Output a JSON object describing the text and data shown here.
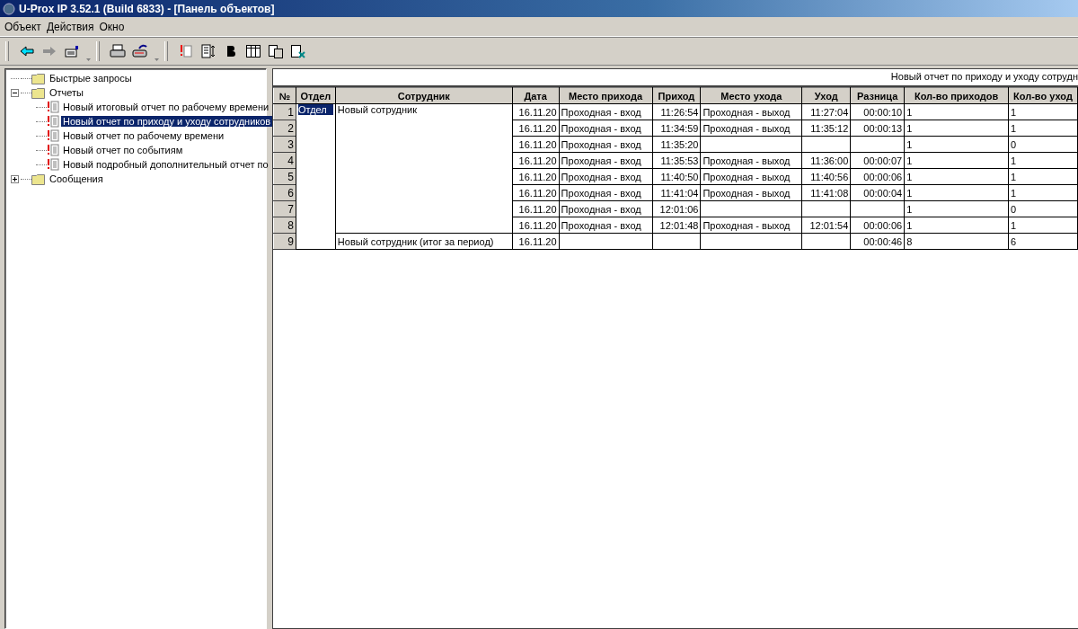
{
  "window": {
    "title": "U-Prox IP 3.52.1 (Build 6833) - [Панель объектов]"
  },
  "menu": [
    "Объект",
    "Действия",
    "Окно"
  ],
  "tree": [
    {
      "label": "Быстрые запросы",
      "kind": "folder",
      "selected": false
    },
    {
      "label": "Отчеты",
      "kind": "folder",
      "expanded": true,
      "selected": false,
      "children": [
        {
          "label": "Новый итоговый отчет по рабочему времени",
          "kind": "report",
          "selected": false
        },
        {
          "label": "Новый отчет по приходу и уходу сотрудников",
          "kind": "report",
          "selected": true
        },
        {
          "label": "Новый отчет по рабочему времени",
          "kind": "report",
          "selected": false
        },
        {
          "label": "Новый отчет по событиям",
          "kind": "report",
          "selected": false
        },
        {
          "label": "Новый подробный дополнительный отчет по",
          "kind": "report",
          "selected": false
        }
      ]
    },
    {
      "label": "Сообщения",
      "kind": "folder",
      "expanded": false,
      "selected": false
    }
  ],
  "report": {
    "title": "Новый отчет по приходу и уходу сотрудн",
    "columns": [
      "№",
      "Отдел",
      "Сотрудник",
      "Дата",
      "Место прихода",
      "Приход",
      "Место ухода",
      "Уход",
      "Разница",
      "Кол-во приходов",
      "Кол-во уход"
    ],
    "department": {
      "text": "Отдел",
      "selected": true
    },
    "employee": "Новый сотрудник",
    "rows": [
      {
        "num": "1",
        "date": "16.11.20",
        "in_place": "Проходная  - вход",
        "in_time": "11:26:54",
        "out_place": "Проходная  - выход",
        "out_time": "11:27:04",
        "diff": "00:00:10",
        "in_count": "1",
        "out_count": "1"
      },
      {
        "num": "2",
        "date": "16.11.20",
        "in_place": "Проходная  - вход",
        "in_time": "11:34:59",
        "out_place": "Проходная  - выход",
        "out_time": "11:35:12",
        "diff": "00:00:13",
        "in_count": "1",
        "out_count": "1"
      },
      {
        "num": "3",
        "date": "16.11.20",
        "in_place": "Проходная  - вход",
        "in_time": "11:35:20",
        "in_count": "1",
        "out_count": "0"
      },
      {
        "num": "4",
        "date": "16.11.20",
        "in_place": "Проходная  - вход",
        "in_time": "11:35:53",
        "out_place": "Проходная  - выход",
        "out_time": "11:36:00",
        "diff": "00:00:07",
        "in_count": "1",
        "out_count": "1"
      },
      {
        "num": "5",
        "date": "16.11.20",
        "in_place": "Проходная  - вход",
        "in_time": "11:40:50",
        "out_place": "Проходная  - выход",
        "out_time": "11:40:56",
        "diff": "00:00:06",
        "in_count": "1",
        "out_count": "1"
      },
      {
        "num": "6",
        "date": "16.11.20",
        "in_place": "Проходная  - вход",
        "in_time": "11:41:04",
        "out_place": "Проходная  - выход",
        "out_time": "11:41:08",
        "diff": "00:00:04",
        "in_count": "1",
        "out_count": "1"
      },
      {
        "num": "7",
        "date": "16.11.20",
        "in_place": "Проходная  - вход",
        "in_time": "12:01:06",
        "in_count": "1",
        "out_count": "0"
      },
      {
        "num": "8",
        "date": "16.11.20",
        "in_place": "Проходная  - вход",
        "in_time": "12:01:48",
        "out_place": "Проходная  - выход",
        "out_time": "12:01:54",
        "diff": "00:00:06",
        "in_count": "1",
        "out_count": "1"
      }
    ],
    "total": {
      "num": "9",
      "employee": "Новый сотрудник (итог за период)",
      "date": "16.11.20",
      "diff": "00:00:46",
      "in_count": "8",
      "out_count": "6"
    }
  }
}
